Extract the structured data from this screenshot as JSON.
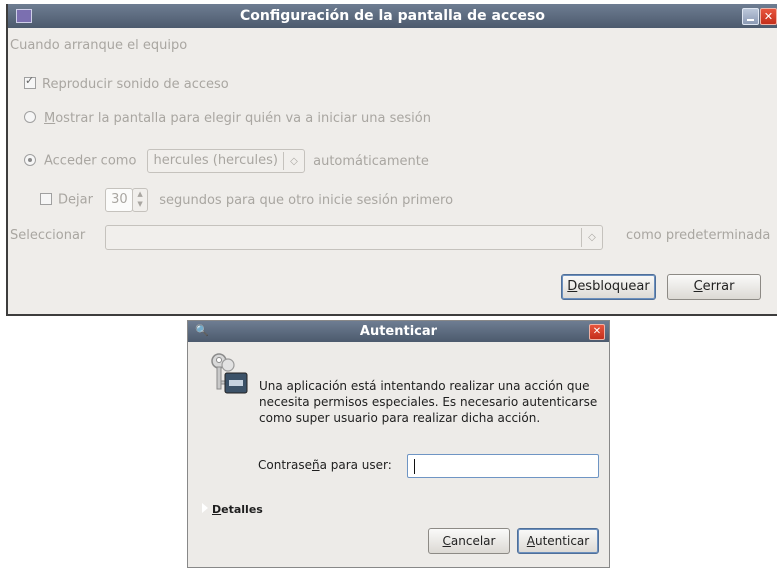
{
  "login_window": {
    "title": "Configuración de la pantalla de acceso",
    "section_label": "Cuando arranque el equipo",
    "play_sound": {
      "label": "Reproducir sonido de acceso",
      "checked": true
    },
    "show_screen": {
      "label_prefix": "",
      "label_underlined": "M",
      "label_rest": "ostrar la pantalla para elegir quién va a iniciar una sesión",
      "selected": false
    },
    "auto_login": {
      "label": "Acceder como",
      "user_value": "hercules (hercules)",
      "suffix": "automáticamente",
      "selected": true
    },
    "delay": {
      "label": "Dejar",
      "seconds": "30",
      "suffix": "segundos para que otro inicie sesión primero",
      "checked": false
    },
    "select_session": {
      "label": "Seleccionar",
      "value": "",
      "suffix": "como predeterminada"
    },
    "buttons": {
      "unlock_u": "D",
      "unlock_rest": "esbloquear",
      "close_u": "C",
      "close_rest": "errar"
    }
  },
  "auth_dialog": {
    "title": "Autenticar",
    "message": "Una aplicación está intentando realizar una acción que necesita permisos especiales. Es necesario autenticarse como super usuario para realizar dicha acción.",
    "password_label_a": "Contrase",
    "password_label_u": "ñ",
    "password_label_b": "a para user:",
    "password_value": "",
    "details_u": "D",
    "details_rest": "etalles",
    "buttons": {
      "cancel_u": "C",
      "cancel_rest": "ancelar",
      "auth_u": "A",
      "auth_rest": "utenticar"
    }
  }
}
